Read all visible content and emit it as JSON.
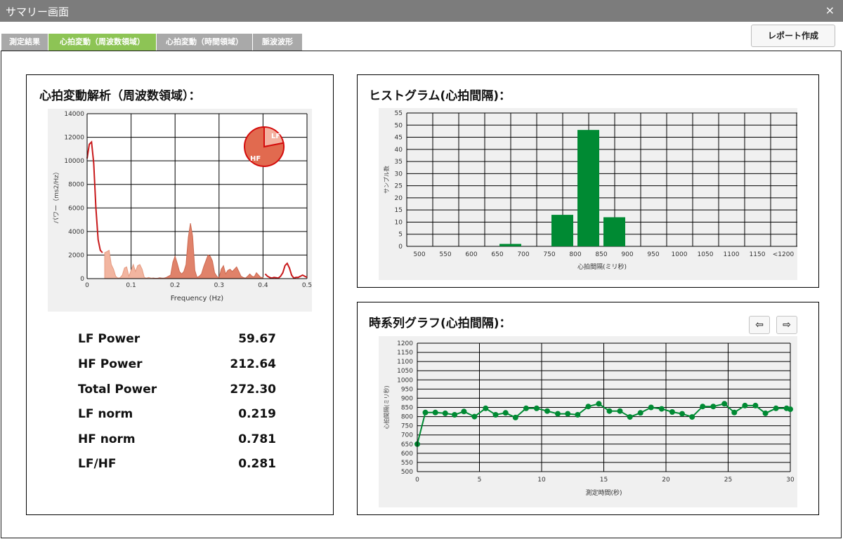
{
  "window": {
    "title": "サマリー画面",
    "close_glyph": "×"
  },
  "tabs": [
    {
      "label": "測定結果",
      "active": false
    },
    {
      "label": "心拍変動（周波数領域）",
      "active": true
    },
    {
      "label": "心拍変動（時間領域）",
      "active": false
    },
    {
      "label": "脈波波形",
      "active": false
    }
  ],
  "toolbar": {
    "report_label": "レポート作成"
  },
  "freq_panel": {
    "title": "心拍変動解析（周波数領域）：",
    "stats": [
      {
        "label": "LF Power",
        "value": "59.67"
      },
      {
        "label": "HF Power",
        "value": "212.64"
      },
      {
        "label": "Total Power",
        "value": "272.30"
      },
      {
        "label": "LF norm",
        "value": "0.219"
      },
      {
        "label": "HF norm",
        "value": "0.781"
      },
      {
        "label": "LF/HF",
        "value": "0.281"
      }
    ]
  },
  "hist_panel": {
    "title": "ヒストグラム(心拍間隔)："
  },
  "ts_panel": {
    "title": "時系列グラフ(心拍間隔)：",
    "prev_glyph": "⇦",
    "next_glyph": "⇨"
  },
  "colors": {
    "accent_tab": "#8dc455",
    "bar": "#008a33",
    "psd_line": "#c8191b",
    "lf_fill": "#f2b5a0",
    "hf_fill": "#e0826a"
  },
  "chart_data": [
    {
      "id": "psd",
      "type": "area",
      "xlabel": "Frequency (Hz)",
      "ylabel": "パワー（ms2/Hz）",
      "xlim": [
        0,
        0.5
      ],
      "ylim": [
        0,
        14000
      ],
      "xticks": [
        0,
        0.1,
        0.2,
        0.3,
        0.4,
        0.5
      ],
      "yticks": [
        0,
        2000,
        4000,
        6000,
        8000,
        10000,
        12000,
        14000
      ],
      "grid": true,
      "series": [
        {
          "x": [
            0,
            0.005,
            0.01,
            0.015,
            0.02,
            0.025,
            0.03,
            0.035,
            0.04,
            0.045,
            0.05,
            0.055,
            0.06,
            0.065,
            0.07,
            0.075,
            0.08,
            0.085,
            0.09,
            0.095,
            0.1,
            0.105,
            0.11,
            0.115,
            0.12,
            0.125,
            0.13,
            0.135,
            0.14,
            0.145,
            0.15,
            0.155,
            0.16,
            0.165,
            0.17,
            0.175,
            0.18,
            0.185,
            0.19,
            0.195,
            0.2,
            0.205,
            0.21,
            0.215,
            0.22,
            0.225,
            0.23,
            0.235,
            0.24,
            0.245,
            0.25,
            0.255,
            0.26,
            0.265,
            0.27,
            0.275,
            0.28,
            0.285,
            0.29,
            0.295,
            0.3,
            0.305,
            0.31,
            0.315,
            0.32,
            0.325,
            0.33,
            0.335,
            0.34,
            0.345,
            0.35,
            0.355,
            0.36,
            0.365,
            0.37,
            0.375,
            0.38,
            0.385,
            0.39,
            0.395,
            0.4,
            0.405,
            0.41,
            0.415,
            0.42,
            0.425,
            0.43,
            0.435,
            0.44,
            0.445,
            0.45,
            0.455,
            0.46,
            0.465,
            0.47,
            0.475,
            0.48,
            0.485,
            0.49,
            0.495,
            0.5
          ],
          "y": [
            10200,
            11400,
            11600,
            9800,
            6000,
            3300,
            2400,
            2200,
            2200,
            2300,
            2400,
            1200,
            800,
            200,
            50,
            80,
            300,
            900,
            1000,
            200,
            700,
            1200,
            600,
            1100,
            1200,
            800,
            100,
            50,
            100,
            50,
            50,
            30,
            30,
            80,
            50,
            50,
            100,
            200,
            300,
            1400,
            1900,
            1300,
            600,
            400,
            600,
            1200,
            3500,
            4700,
            3600,
            700,
            100,
            200,
            400,
            1000,
            1500,
            2000,
            1900,
            1500,
            500,
            200,
            50,
            800,
            1100,
            400,
            700,
            800,
            600,
            800,
            1000,
            600,
            200,
            100,
            50,
            200,
            400,
            200,
            150,
            500,
            300,
            100,
            100,
            400,
            200,
            100,
            50,
            100,
            80,
            50,
            200,
            500,
            1100,
            1300,
            900,
            300,
            50,
            100,
            100,
            200,
            300,
            200,
            100
          ]
        }
      ],
      "bands": {
        "lf": [
          0.04,
          0.15
        ],
        "hf": [
          0.15,
          0.4
        ]
      },
      "pie": {
        "slices": [
          {
            "label": "LF",
            "value": 0.219
          },
          {
            "label": "HF",
            "value": 0.781
          }
        ]
      }
    },
    {
      "id": "histogram",
      "type": "bar",
      "xlabel": "心拍間隔(ミリ秒)",
      "ylabel": "サンプル数",
      "categories": [
        "500",
        "550",
        "600",
        "650",
        "700",
        "750",
        "800",
        "850",
        "900",
        "950",
        "1000",
        "1050",
        "1100",
        "1150",
        "<1200"
      ],
      "values": [
        0,
        0,
        0,
        1,
        0,
        13,
        48,
        12,
        0,
        0,
        0,
        0,
        0,
        0,
        0
      ],
      "ylim": [
        0,
        55
      ],
      "yticks": [
        0,
        5,
        10,
        15,
        20,
        25,
        30,
        35,
        40,
        45,
        50,
        55
      ],
      "grid": true
    },
    {
      "id": "timeseries",
      "type": "line",
      "xlabel": "測定時間(秒)",
      "ylabel": "心拍間隔(ミリ秒)",
      "xlim": [
        0,
        30
      ],
      "ylim": [
        500,
        1200
      ],
      "xticks": [
        0,
        5,
        10,
        15,
        20,
        25,
        30
      ],
      "yticks": [
        500,
        550,
        600,
        650,
        700,
        750,
        800,
        850,
        900,
        950,
        1000,
        1050,
        1100,
        1150,
        1200
      ],
      "grid": true,
      "series": [
        {
          "x": [
            0,
            0.65,
            1.45,
            2.25,
            3.0,
            3.75,
            4.6,
            5.5,
            6.3,
            7.1,
            7.9,
            8.75,
            9.6,
            10.45,
            11.3,
            12.1,
            12.9,
            13.75,
            14.6,
            15.45,
            16.3,
            17.1,
            17.95,
            18.8,
            19.65,
            20.5,
            21.3,
            22.1,
            22.95,
            23.8,
            24.7,
            25.5,
            26.35,
            27.2,
            28.0,
            28.85,
            29.7,
            30
          ],
          "y": [
            650,
            822,
            822,
            818,
            810,
            828,
            800,
            845,
            810,
            820,
            795,
            845,
            845,
            830,
            815,
            815,
            810,
            855,
            870,
            830,
            830,
            798,
            820,
            850,
            842,
            825,
            815,
            798,
            855,
            855,
            870,
            822,
            860,
            860,
            818,
            845,
            845,
            840
          ]
        }
      ]
    }
  ]
}
